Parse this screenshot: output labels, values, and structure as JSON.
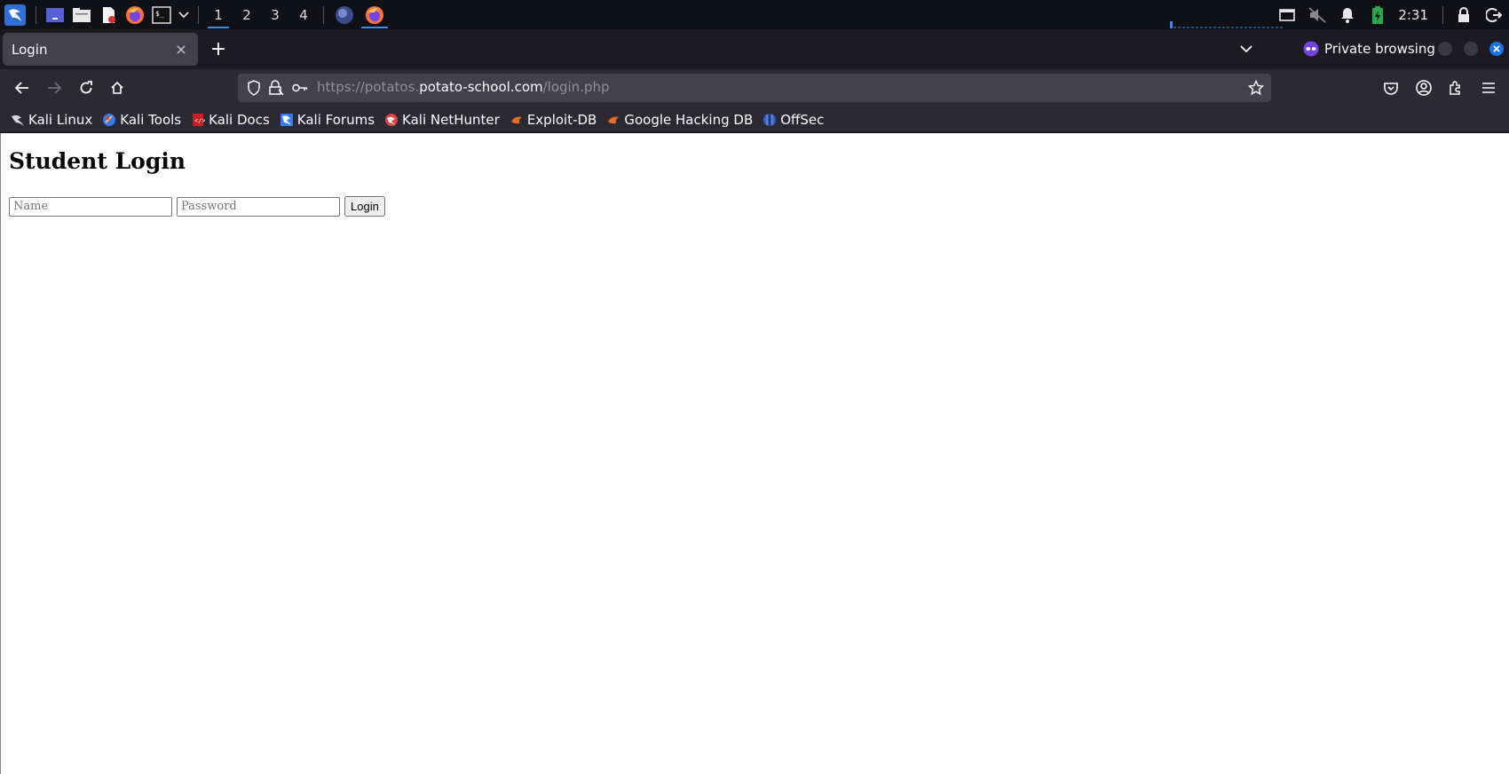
{
  "taskbar": {
    "workspaces": [
      "1",
      "2",
      "3",
      "4"
    ],
    "active_workspace": "1",
    "clock": "2:31",
    "accent_color": "#3a8fe6"
  },
  "browser": {
    "tab": {
      "title": "Login",
      "close_label": "×"
    },
    "new_tab_label": "+",
    "private_label": "Private browsing",
    "url": {
      "prefix": "https://potatos.",
      "host": "potato-school.com",
      "path": "/login.php"
    },
    "bookmarks": [
      {
        "label": "Kali Linux",
        "icon": "kali-dragon-icon"
      },
      {
        "label": "Kali Tools",
        "icon": "kali-tools-icon"
      },
      {
        "label": "Kali Docs",
        "icon": "kali-docs-icon"
      },
      {
        "label": "Kali Forums",
        "icon": "kali-forums-icon"
      },
      {
        "label": "Kali NetHunter",
        "icon": "nethunter-icon"
      },
      {
        "label": "Exploit-DB",
        "icon": "exploit-db-icon"
      },
      {
        "label": "Google Hacking DB",
        "icon": "ghdb-icon"
      },
      {
        "label": "OffSec",
        "icon": "offsec-icon"
      }
    ]
  },
  "page": {
    "heading": "Student Login",
    "name_placeholder": "Name",
    "password_placeholder": "Password",
    "login_label": "Login"
  }
}
